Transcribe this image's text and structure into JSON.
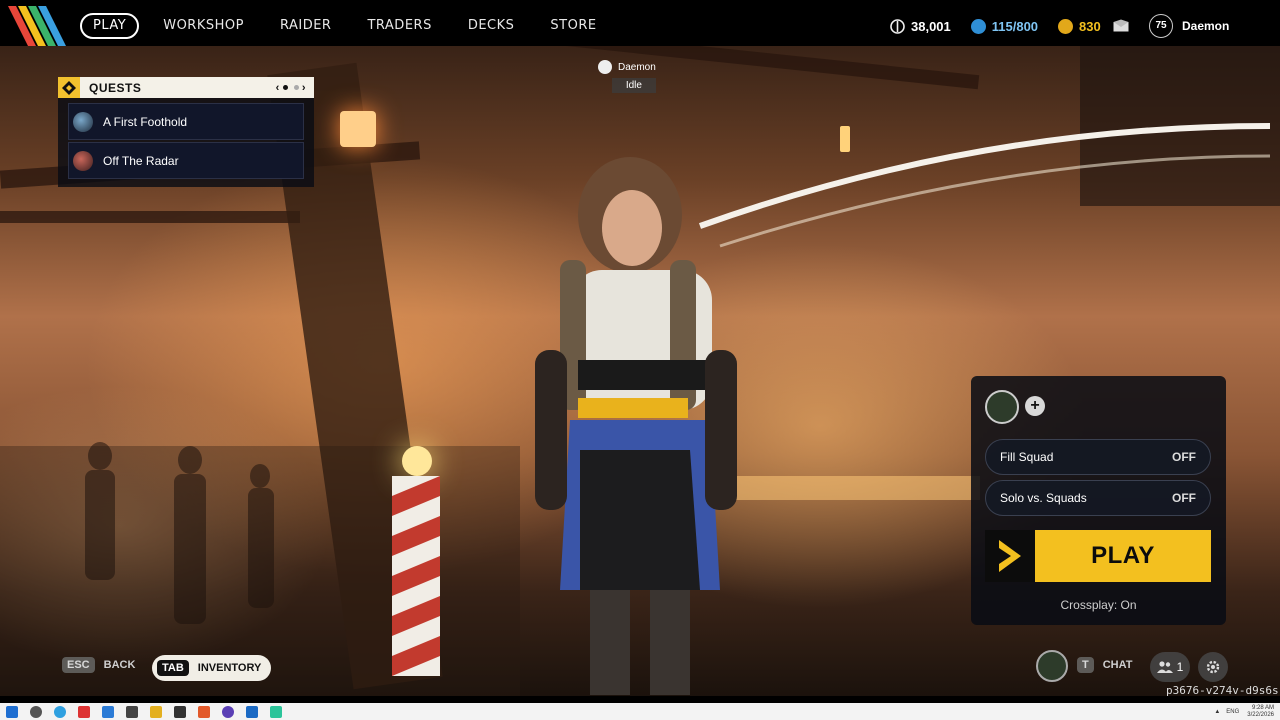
{
  "nav": {
    "items": [
      "PLAY",
      "WORKSHOP",
      "RAIDER",
      "TRADERS",
      "DECKS",
      "STORE"
    ],
    "active": "PLAY"
  },
  "currencies": {
    "coins": "38,001",
    "tokens": "115/800",
    "raider_tokens": "830"
  },
  "profile": {
    "level": "75",
    "name": "Daemon"
  },
  "quests": {
    "title": "QUESTS",
    "items": [
      {
        "label": "A First Foothold"
      },
      {
        "label": "Off The Radar"
      }
    ]
  },
  "player_tag": {
    "name": "Daemon",
    "status": "Idle"
  },
  "panel": {
    "fill_squad": {
      "label": "Fill Squad",
      "state": "OFF"
    },
    "solo_vs_squads": {
      "label": "Solo vs. Squads",
      "state": "OFF"
    },
    "play_label": "PLAY",
    "crossplay": "Crossplay: On"
  },
  "hints": {
    "back_key": "ESC",
    "back_label": "BACK",
    "tab_key": "TAB",
    "tab_label": "INVENTORY",
    "chat_key": "T",
    "chat_label": "CHAT",
    "friends_count": "1"
  },
  "build_id": "p3676-v274v-d9s6s",
  "taskbar": {
    "time": "9:28 AM",
    "date": "3/22/2026",
    "lang": "ENG"
  },
  "colors": {
    "accent": "#f3c01f",
    "panel_bg": "#080c14",
    "topbar_bg": "#000000"
  },
  "icons": {
    "coins": "coin-icon",
    "tokens": "token-icon",
    "raider_tokens": "raider-token-icon",
    "mail": "mail-icon",
    "settings": "gear-icon",
    "friends": "friends-icon"
  }
}
